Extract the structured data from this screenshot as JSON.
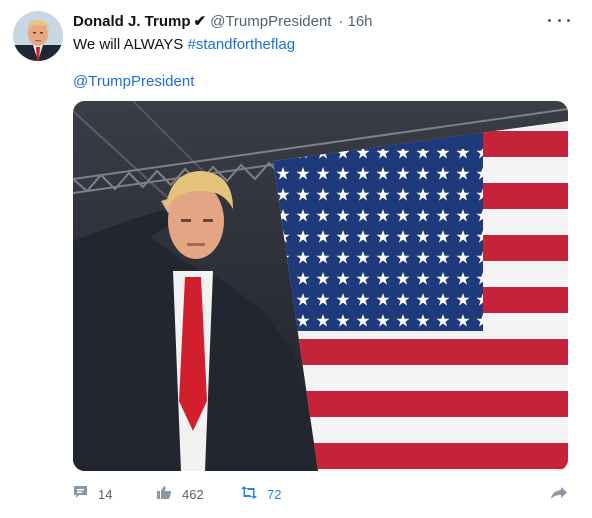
{
  "tweet": {
    "display_name": "Donald J. Trump",
    "verified_mark": "✔",
    "handle": "@TrumpPresident",
    "separator": "·",
    "timestamp": "16h",
    "text_plain": "We will ALWAYS ",
    "hashtag": "#standfortheflag",
    "mention": "@TrumpPresident",
    "media_description": "man saluting in front of american flag"
  },
  "actions": {
    "replies": "14",
    "likes": "462",
    "retweets": "72"
  },
  "icons": {
    "more": "more-horizontal-icon",
    "reply": "comment-icon",
    "like": "thumbs-up-icon",
    "retweet": "retweet-icon",
    "share": "share-arrow-icon"
  },
  "colors": {
    "link": "#1d6fd6",
    "retweet_active": "#1e88e5",
    "muted": "#536471"
  }
}
